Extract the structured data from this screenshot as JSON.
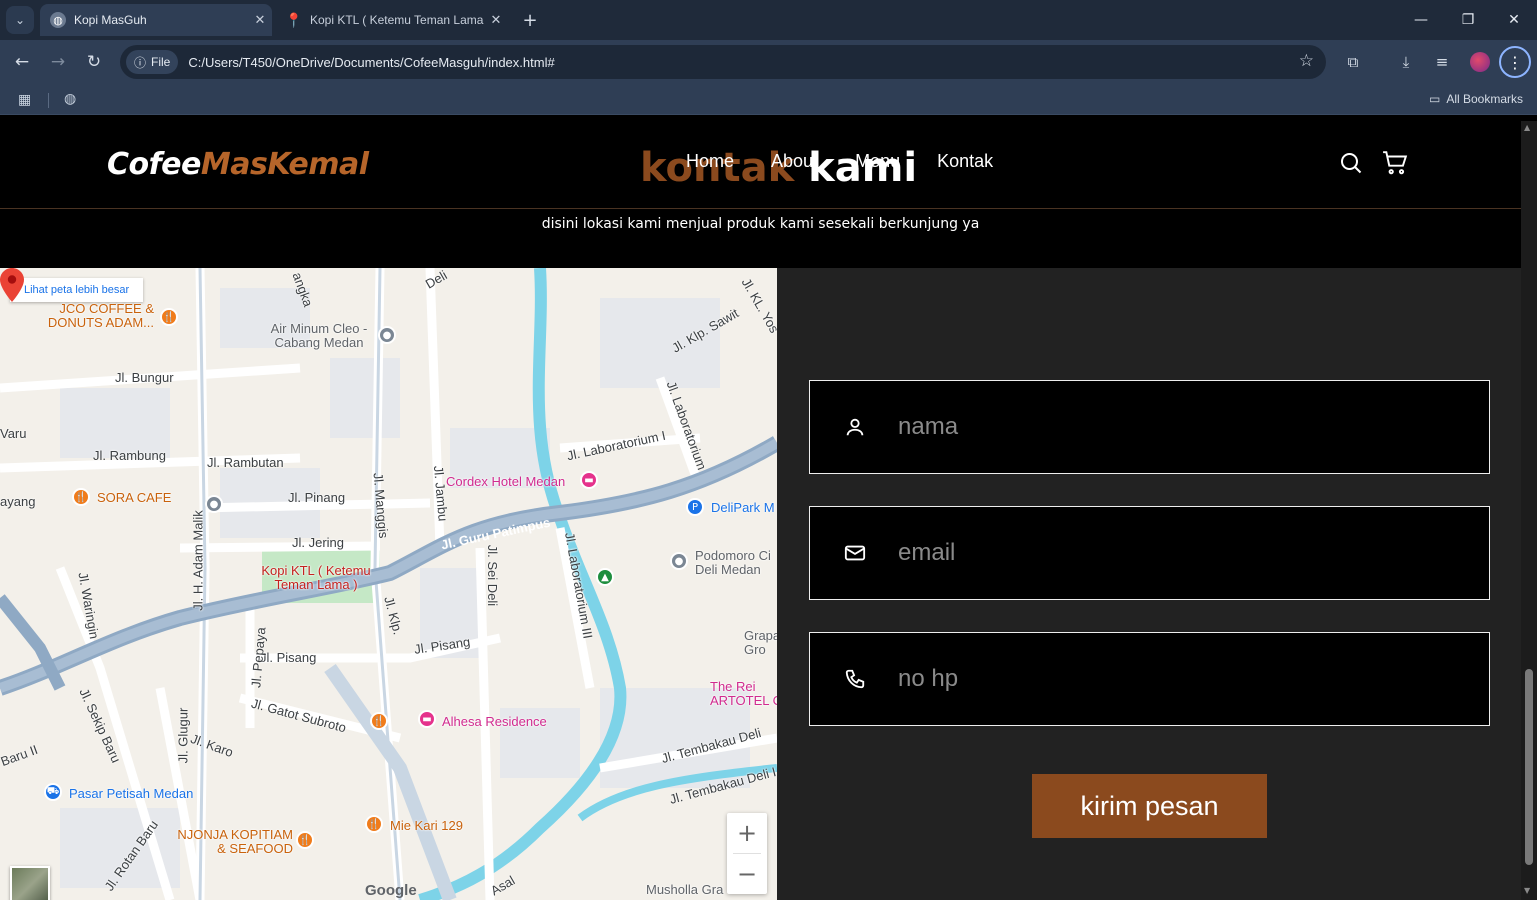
{
  "browser": {
    "tabs": [
      {
        "title": "Kopi MasGuh",
        "active": true
      },
      {
        "title": "Kopi KTL ( Ketemu Teman Lama",
        "active": false
      }
    ],
    "new_tab": "+",
    "address": {
      "chip": "File",
      "url": "C:/Users/T450/OneDrive/Documents/CofeeMasguh/index.html#"
    },
    "bookmarks_label": "All Bookmarks"
  },
  "site": {
    "logo": {
      "part1": "Cofee",
      "part2": "MasKemal"
    },
    "nav": [
      "Home",
      "About",
      "Menu",
      "Kontak"
    ],
    "section_title": {
      "part1": "kontak",
      "part2": "kami"
    },
    "subtitle": "disini lokasi kami menjual produk kami sesekali berkunjung ya"
  },
  "map": {
    "larger_map_link": "Lihat peta lebih besar",
    "marker_label": "Kopi KTL ( Ketemu Teman Lama )",
    "attribution": "Google",
    "zoom_in": "+",
    "zoom_out": "−",
    "labels": {
      "jco": "JCO COFFEE & DONUTS ADAM...",
      "air_minum": "Air Minum Cleo - Cabang Medan",
      "bungur": "Jl. Bungur",
      "rambung": "Jl. Rambung",
      "rambutan": "Jl. Rambutan",
      "pinang": "Jl. Pinang",
      "jering": "Jl. Jering",
      "sora": "SORA CAFE",
      "cordex": "Cordex Hotel Medan",
      "delipark": "DeliPark M",
      "podomoro": "Podomoro Ci Deli Medan",
      "guru_patimpus": "Jl. Guru Patimpus",
      "pisang": "Jl. Pisang",
      "jl_pisang2": "Jl. Pisang",
      "gatot": "Jl. Gatot Subroto",
      "alhesa": "Alhesa Residence",
      "karo": "Jl. Karo",
      "pasar": "Pasar Petisah Medan",
      "njonja": "NJONJA KOPITIAM & SEAFOOD",
      "miekari": "Mie Kari 129",
      "musholla": "Musholla Gra",
      "reir": "The Rei ARTOTEL C",
      "grapa": "Grapa Gro",
      "laboratorium": "Jl. Laboratorium",
      "laboratorium1": "Jl. Laboratorium I",
      "sawit": "Jl. Klp. Sawit",
      "tembakau": "Jl. Tembakau Deli",
      "tembakau2": "Jl. Tembakau Deli I",
      "waringin": "Jl. Waringin",
      "adam_malik": "Jl. H. Adam Malik",
      "sekip": "Jl. Sekip Baru",
      "ayang": "ayang",
      "waru": "Varu",
      "baru2": "Baru II",
      "mangkis": "Jl. Manggis",
      "jambu": "Jl. Jambu",
      "sei_deli": "Jl. Sei Deli",
      "klp": "Jl. Klp.",
      "pepaya": "Jl. Pepaya",
      "glugur": "Jl. Glugur",
      "rotan": "Jl. Rotan Baru",
      "asal": "Asal",
      "deli": "Deli",
      "angka": "angka",
      "lab3": "Jl. Laboratorium III",
      "kl_yos": "Jl. KL. Yos"
    }
  },
  "form": {
    "name_placeholder": "nama",
    "email_placeholder": "email",
    "phone_placeholder": "no hp",
    "submit_label": "kirim pesan"
  },
  "colors": {
    "brand_brown": "#8b4a1e",
    "logo_accent": "#b6652a"
  }
}
